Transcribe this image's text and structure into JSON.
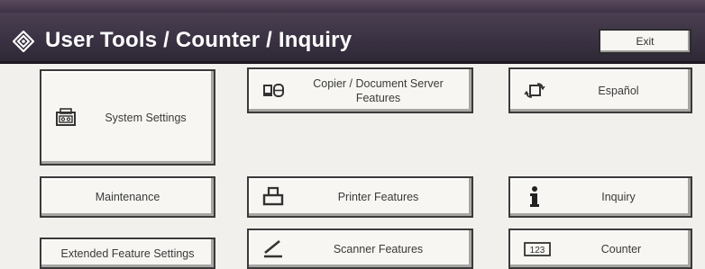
{
  "header": {
    "title": "User Tools / Counter / Inquiry",
    "exit_label": "Exit"
  },
  "left": {
    "system_settings": "System Settings",
    "maintenance": "Maintenance",
    "extended_feature_settings": "Extended Feature Settings"
  },
  "middle": {
    "copier_line1": "Copier / Document Server",
    "copier_line2": "Features",
    "printer": "Printer Features",
    "scanner": "Scanner Features"
  },
  "right": {
    "language": "Español",
    "inquiry": "Inquiry",
    "counter": "Counter",
    "counter_icon_text": "123"
  },
  "icons": {
    "logo": "tools-diamond-icon",
    "system": "system-settings-icon",
    "copier": "copier-document-server-icon",
    "language": "language-switch-icon",
    "printer": "printer-icon",
    "scanner": "scanner-icon",
    "inquiry": "info-icon",
    "counter": "counter-icon"
  }
}
